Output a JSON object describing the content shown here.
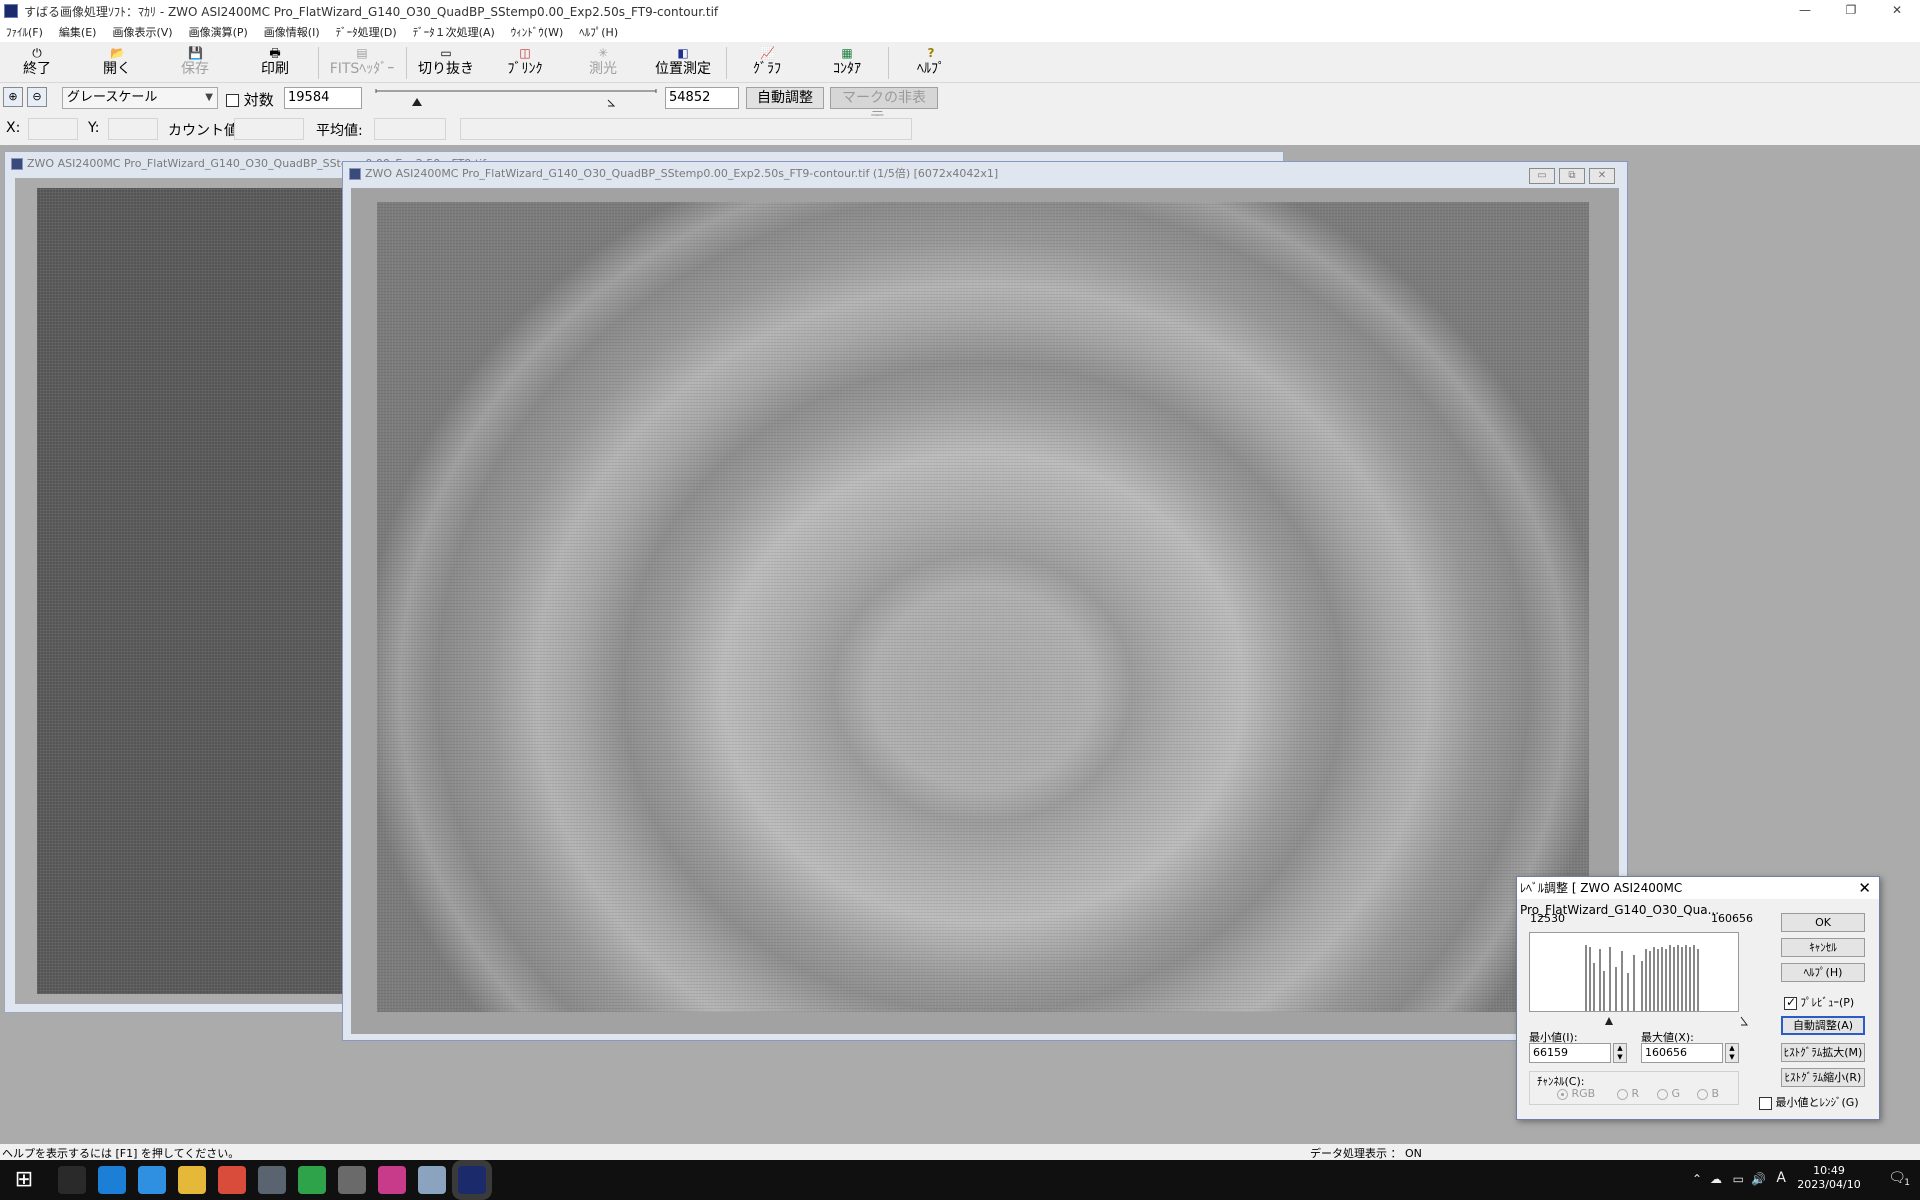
{
  "window": {
    "title": "すばる画像処理ｿﾌﾄ：ﾏｶﾘ - ZWO ASI2400MC Pro_FlatWizard_G140_O30_QuadBP_SStemp0.00_Exp2.50s_FT9-contour.tif",
    "minimize": "—",
    "restore": "❐",
    "close": "✕"
  },
  "menu": [
    "ﾌｧｲﾙ(F)",
    "編集(E)",
    "画像表示(V)",
    "画像演算(P)",
    "画像情報(I)",
    "ﾃﾞｰﾀ処理(D)",
    "ﾃﾞｰﾀ１次処理(A)",
    "ｳｨﾝﾄﾞｳ(W)",
    "ﾍﾙﾌﾟ(H)"
  ],
  "toolbar": {
    "exit": "終了",
    "open": "開く",
    "save": "保存",
    "print": "印刷",
    "fits_header": "FITSﾍｯﾀﾞｰ",
    "crop": "切り抜き",
    "blink": "ﾌﾞﾘﾝｸ",
    "photometry": "測光",
    "astrometry": "位置測定",
    "graph": "ｸﾞﾗﾌ",
    "contour": "ｺﾝﾀｱ",
    "help": "ﾍﾙﾌﾟ"
  },
  "icons": {
    "exit": "⏻",
    "open": "📂",
    "save": "💾",
    "print": "🖶",
    "fits": "▤",
    "crop": "▭",
    "blink": "◫",
    "photometry": "✳",
    "astrometry": "◧",
    "graph": "📈",
    "contour": "▦",
    "help": "?"
  },
  "toolbar2": {
    "zoom_in": "⊕",
    "zoom_out": "⊖",
    "color_mode": "グレースケール",
    "log_label": "対数",
    "log_checked": false,
    "min_value": "19584",
    "max_value": "54852",
    "auto_adjust": "自動調整",
    "hide_marks": "マークの非表示..."
  },
  "inforow": {
    "x_label": "X:",
    "y_label": "Y:",
    "count_label": "カウント値:",
    "mean_label": "平均値:"
  },
  "mdi": {
    "back_window_title": "ZWO ASI2400MC Pro_FlatWizard_G140_O30_QuadBP_SStemp0.00_Exp2.50s_FT9.tif",
    "front_window_title": "ZWO ASI2400MC Pro_FlatWizard_G140_O30_QuadBP_SStemp0.00_Exp2.50s_FT9-contour.tif (1/5倍) [6072x4042x1]",
    "btn_min": "▭",
    "btn_max": "⧉",
    "btn_close": "✕"
  },
  "dialog": {
    "title": "ﾚﾍﾞﾙ調整 [ ZWO ASI2400MC Pro_FlatWizard_G140_O30_Qua...",
    "close": "✕",
    "range_min": "12530",
    "range_max": "160656",
    "ok": "OK",
    "cancel": "ｷｬﾝｾﾙ",
    "help": "ﾍﾙﾌﾟ(H)",
    "preview_label": "ﾌﾟﾚﾋﾞｭｰ(P)",
    "preview_checked": true,
    "auto": "自動調整(A)",
    "hist_expand": "ﾋｽﾄｸﾞﾗﾑ拡大(M)",
    "hist_shrink": "ﾋｽﾄｸﾞﾗﾑ縮小(R)",
    "min_label": "最小値(I):",
    "min_value": "66159",
    "max_label": "最大値(X):",
    "max_value": "160656",
    "channel_label": "ﾁｬﾝﾈﾙ(C):",
    "channels": [
      "RGB",
      "R",
      "G",
      "B"
    ],
    "min_range_label": "最小値とﾚﾝｼﾞ(G)",
    "min_range_checked": false
  },
  "status": {
    "help_text": "ヘルプを表示するには [F1] を押してください。",
    "data_display": "データ処理表示 ： ON"
  },
  "taskbar": {
    "time": "10:49",
    "date": "2023/04/10",
    "ime": "A",
    "notif_count": "1",
    "start_icon": "⊞",
    "apps": [
      {
        "name": "search-task-view",
        "color": "#2a2a2a"
      },
      {
        "name": "edge",
        "color": "#1b7fd6"
      },
      {
        "name": "store",
        "color": "#2f8fe0"
      },
      {
        "name": "explorer",
        "color": "#e6b83a"
      },
      {
        "name": "chrome",
        "color": "#d94b3b"
      },
      {
        "name": "calculator",
        "color": "#5a6470"
      },
      {
        "name": "app-green",
        "color": "#2fa34a"
      },
      {
        "name": "app-draw",
        "color": "#6a6a6a"
      },
      {
        "name": "app-notes",
        "color": "#c83a8a"
      },
      {
        "name": "app-paint",
        "color": "#8aa4c0"
      },
      {
        "name": "makali",
        "color": "#1b2a6b"
      }
    ]
  }
}
